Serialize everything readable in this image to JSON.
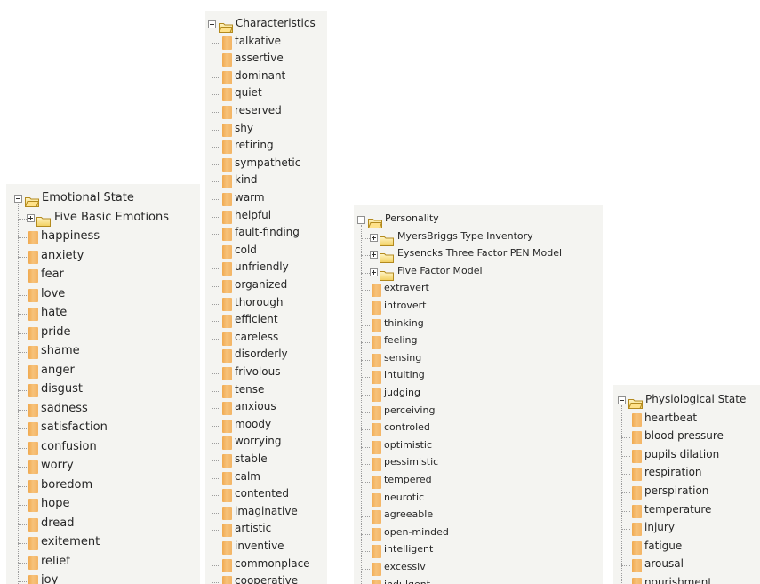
{
  "trees": [
    {
      "id": "emotional-state",
      "root": "Emotional State",
      "groups": [
        "Five Basic Emotions"
      ],
      "items": [
        "happiness",
        "anxiety",
        "fear",
        "love",
        "hate",
        "pride",
        "shame",
        "anger",
        "disgust",
        "sadness",
        "satisfaction",
        "confusion",
        "worry",
        "boredom",
        "hope",
        "dread",
        "exitement",
        "relief",
        "joy"
      ]
    },
    {
      "id": "characteristics",
      "root": "Characteristics",
      "groups": [],
      "items": [
        "talkative",
        "assertive",
        "dominant",
        "quiet",
        "reserved",
        "shy",
        "retiring",
        "sympathetic",
        "kind",
        "warm",
        "helpful",
        "fault-finding",
        "cold",
        "unfriendly",
        "organized",
        "thorough",
        "efficient",
        "careless",
        "disorderly",
        "frivolous",
        "tense",
        "anxious",
        "moody",
        "worrying",
        "stable",
        "calm",
        "contented",
        "imaginative",
        "artistic",
        "inventive",
        "commonplace",
        "cooperative"
      ]
    },
    {
      "id": "personality",
      "root": "Personality",
      "groups": [
        "MyersBriggs Type Inventory",
        "Eysencks Three Factor PEN Model",
        "Five Factor Model"
      ],
      "items": [
        "extravert",
        "introvert",
        "thinking",
        "feeling",
        "sensing",
        "intuiting",
        "judging",
        "perceiving",
        "controled",
        "optimistic",
        "pessimistic",
        "tempered",
        "neurotic",
        "agreeable",
        "open-minded",
        "intelligent",
        "excessiv",
        "indulgent"
      ]
    },
    {
      "id": "physiological-state",
      "root": "Physiological State",
      "groups": [],
      "items": [
        "heartbeat",
        "blood pressure",
        "pupils dilation",
        "respiration",
        "perspiration",
        "temperature",
        "injury",
        "fatigue",
        "arousal",
        "nourishment"
      ]
    }
  ]
}
